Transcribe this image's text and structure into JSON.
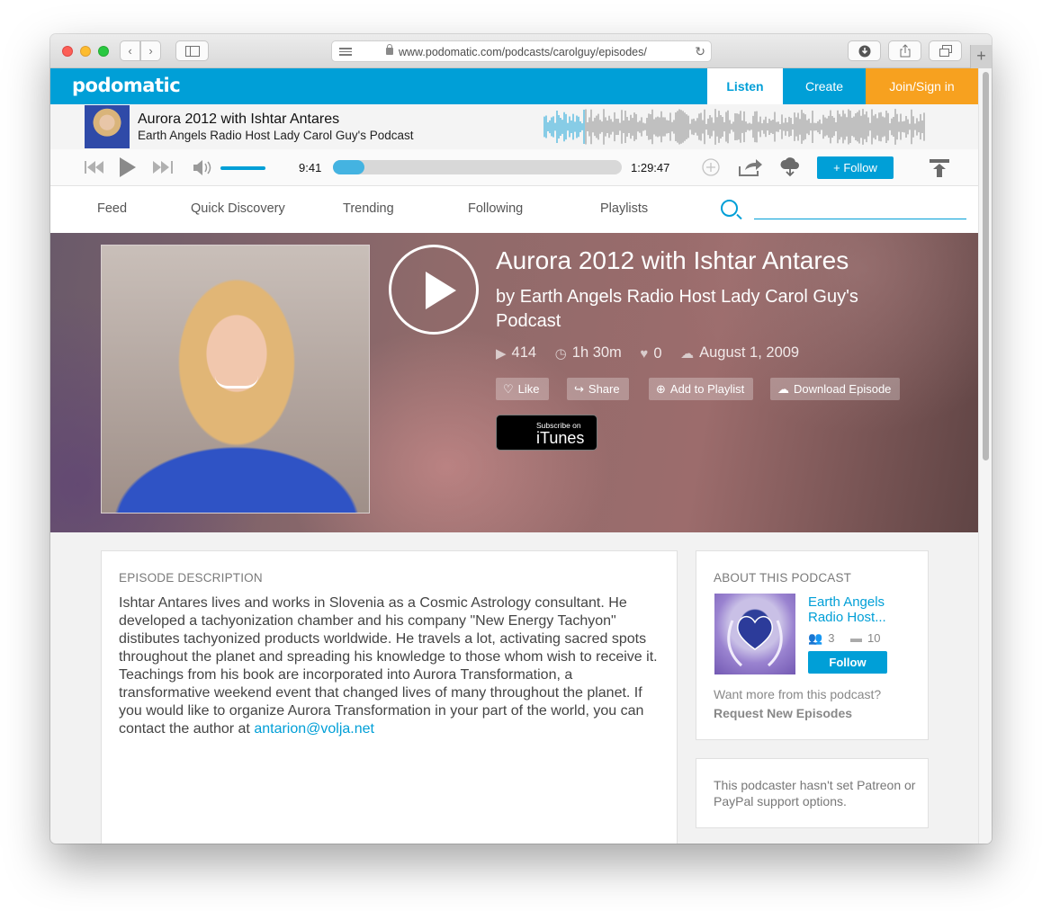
{
  "browser": {
    "url_main": "www.podomatic.com/podcasts/carolguy/episodes/",
    "url_faded": ""
  },
  "header": {
    "logo": "podomatic",
    "tabs": {
      "listen": "Listen",
      "create": "Create",
      "join": "Join/Sign in"
    }
  },
  "now_playing": {
    "title": "Aurora 2012 with Ishtar Antares",
    "subtitle": "Earth Angels Radio Host Lady Carol Guy's Podcast",
    "current_time": "9:41",
    "total_time": "1:29:47",
    "progress_fraction": 0.108,
    "volume_fraction": 1.0,
    "follow_label": "+ Follow"
  },
  "subnav": {
    "items": [
      "Feed",
      "Quick Discovery",
      "Trending",
      "Following",
      "Playlists"
    ],
    "search_placeholder": ""
  },
  "episode": {
    "title": "Aurora 2012 with Ishtar Antares",
    "by_prefix": "by",
    "podcast_name": "Earth Angels Radio Host Lady Carol Guy's Podcast",
    "plays": "414",
    "duration": "1h 30m",
    "likes": "0",
    "date": "August 1, 2009",
    "actions": {
      "like": "Like",
      "share": "Share",
      "add_playlist": "Add to Playlist",
      "download": "Download Episode"
    },
    "itunes": {
      "small": "Subscribe on",
      "big": "iTunes"
    }
  },
  "description": {
    "heading": "EPISODE DESCRIPTION",
    "text": "Ishtar Antares lives and works in Slovenia as a Cosmic Astrology consultant. He developed a tachyonization chamber and his company \"New Energy Tachyon\" distibutes tachyonized products worldwide. He travels a lot, activating sacred spots throughout the planet and spreading his knowledge to those whom wish to receive it. Teachings from his book are incorporated into Aurora Transformation, a transformative weekend event that changed lives of many throughout the planet. If you would like to organize Aurora Transformation in your part of the world, you can contact the author at",
    "email": "antarion@volja.net"
  },
  "about": {
    "heading": "ABOUT THIS PODCAST",
    "title": "Earth Angels Radio Host...",
    "followers": "3",
    "episodes": "10",
    "follow_label": "Follow",
    "more_text": "Want more from this podcast?",
    "request_text": "Request New Episodes"
  },
  "support": {
    "text": "This podcaster hasn't set Patreon or PayPal support options."
  },
  "colors": {
    "brand": "#009fd7",
    "join": "#f7a11f"
  }
}
